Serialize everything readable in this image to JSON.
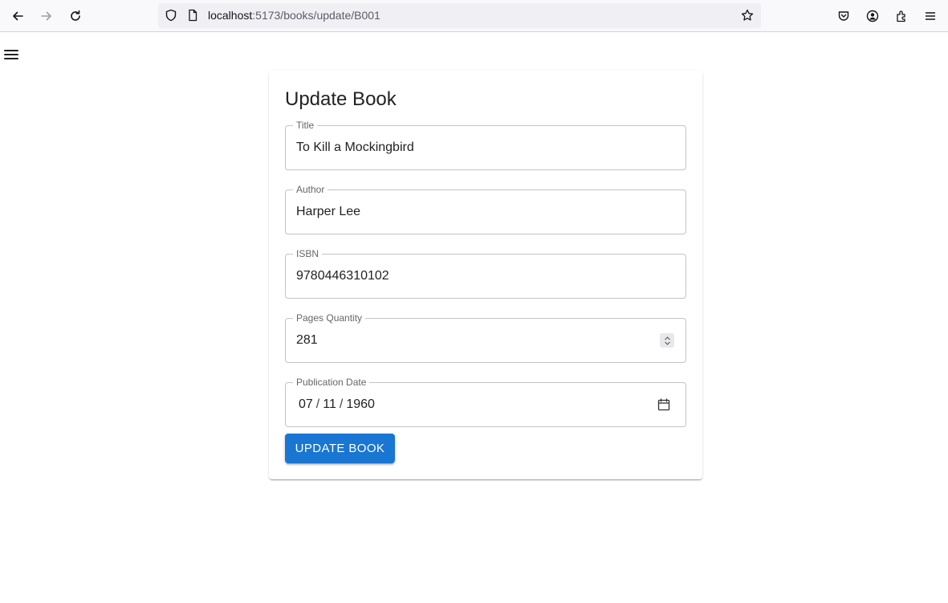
{
  "browser": {
    "url_host": "localhost",
    "url_rest": ":5173/books/update/B001"
  },
  "form": {
    "title": "Update Book",
    "fields": {
      "title": {
        "label": "Title",
        "value": "To Kill a Mockingbird"
      },
      "author": {
        "label": "Author",
        "value": "Harper Lee"
      },
      "isbn": {
        "label": "ISBN",
        "value": "9780446310102"
      },
      "pages": {
        "label": "Pages Quantity",
        "value": "281"
      },
      "publication_date": {
        "label": "Publication Date",
        "month": "07",
        "day": "11",
        "year": "1960",
        "separator": "/"
      }
    },
    "submit_label": "Update Book"
  },
  "icons": {
    "back": "back-arrow-icon",
    "forward": "forward-arrow-icon",
    "reload": "reload-icon",
    "shield": "tracking-protection-shield-icon",
    "page": "page-info-icon",
    "bookmark": "bookmark-star-icon",
    "pocket": "pocket-icon",
    "account": "account-icon",
    "extensions": "extensions-icon",
    "app_menu": "app-menu-icon",
    "nav_menu": "hamburger-menu-icon",
    "calendar": "calendar-icon",
    "spinner": "number-spinner-icon"
  },
  "colors": {
    "primary": "#1976d2",
    "toolbar_bg": "#f9f9fb",
    "urlbar_bg": "#f0f0f4"
  }
}
